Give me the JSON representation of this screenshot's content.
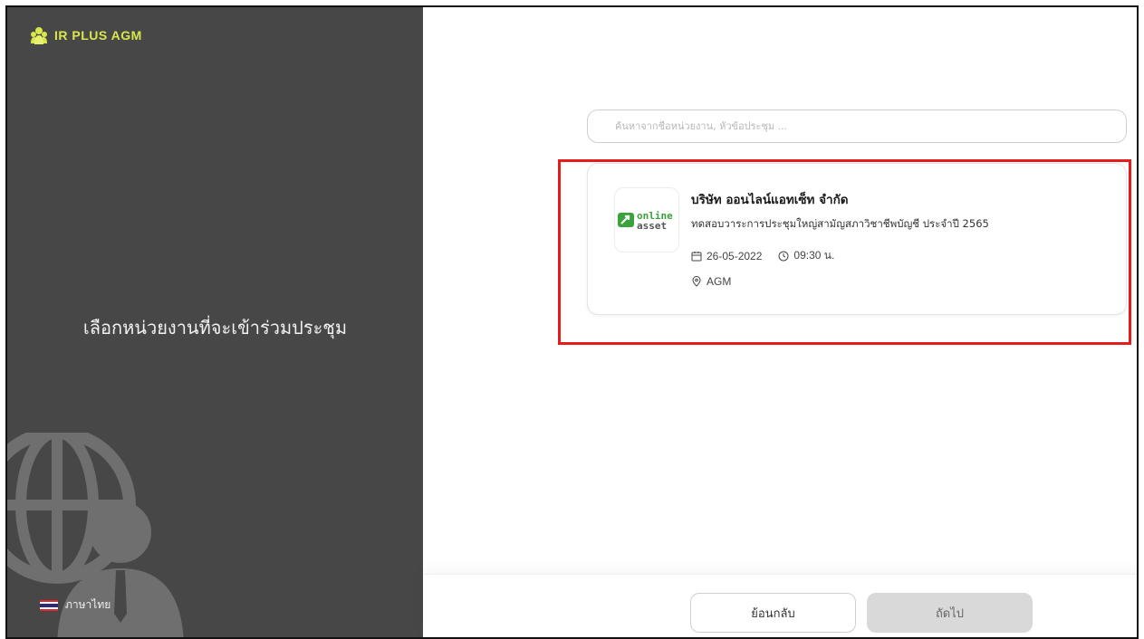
{
  "brand": {
    "name": "IR PLUS AGM",
    "accent": "#d8e84a"
  },
  "left_panel": {
    "title": "เลือกหน่วยงานที่จะเข้าร่วมประชุม",
    "language_label": "ภาษาไทย",
    "background": "#474747"
  },
  "search": {
    "placeholder": "ค้นหาจากชื่อหน่วยงาน, หัวข้อประชุม ..."
  },
  "meeting_card": {
    "logo_text_line1": "online",
    "logo_text_line2": "asset",
    "organization": "บริษัท ออนไลน์แอทเซ็ท จำกัด",
    "title": "ทดสอบวาระการประชุมใหญ่สามัญสภาวิชาชีพบัญชี ประจำปี 2565",
    "date": "26-05-2022",
    "time": "09:30 น.",
    "type": "AGM",
    "logo_color": "#3aa33a",
    "highlight_color": "#e61b1b"
  },
  "footer": {
    "back_label": "ย้อนกลับ",
    "next_label": "ถัดไป"
  }
}
